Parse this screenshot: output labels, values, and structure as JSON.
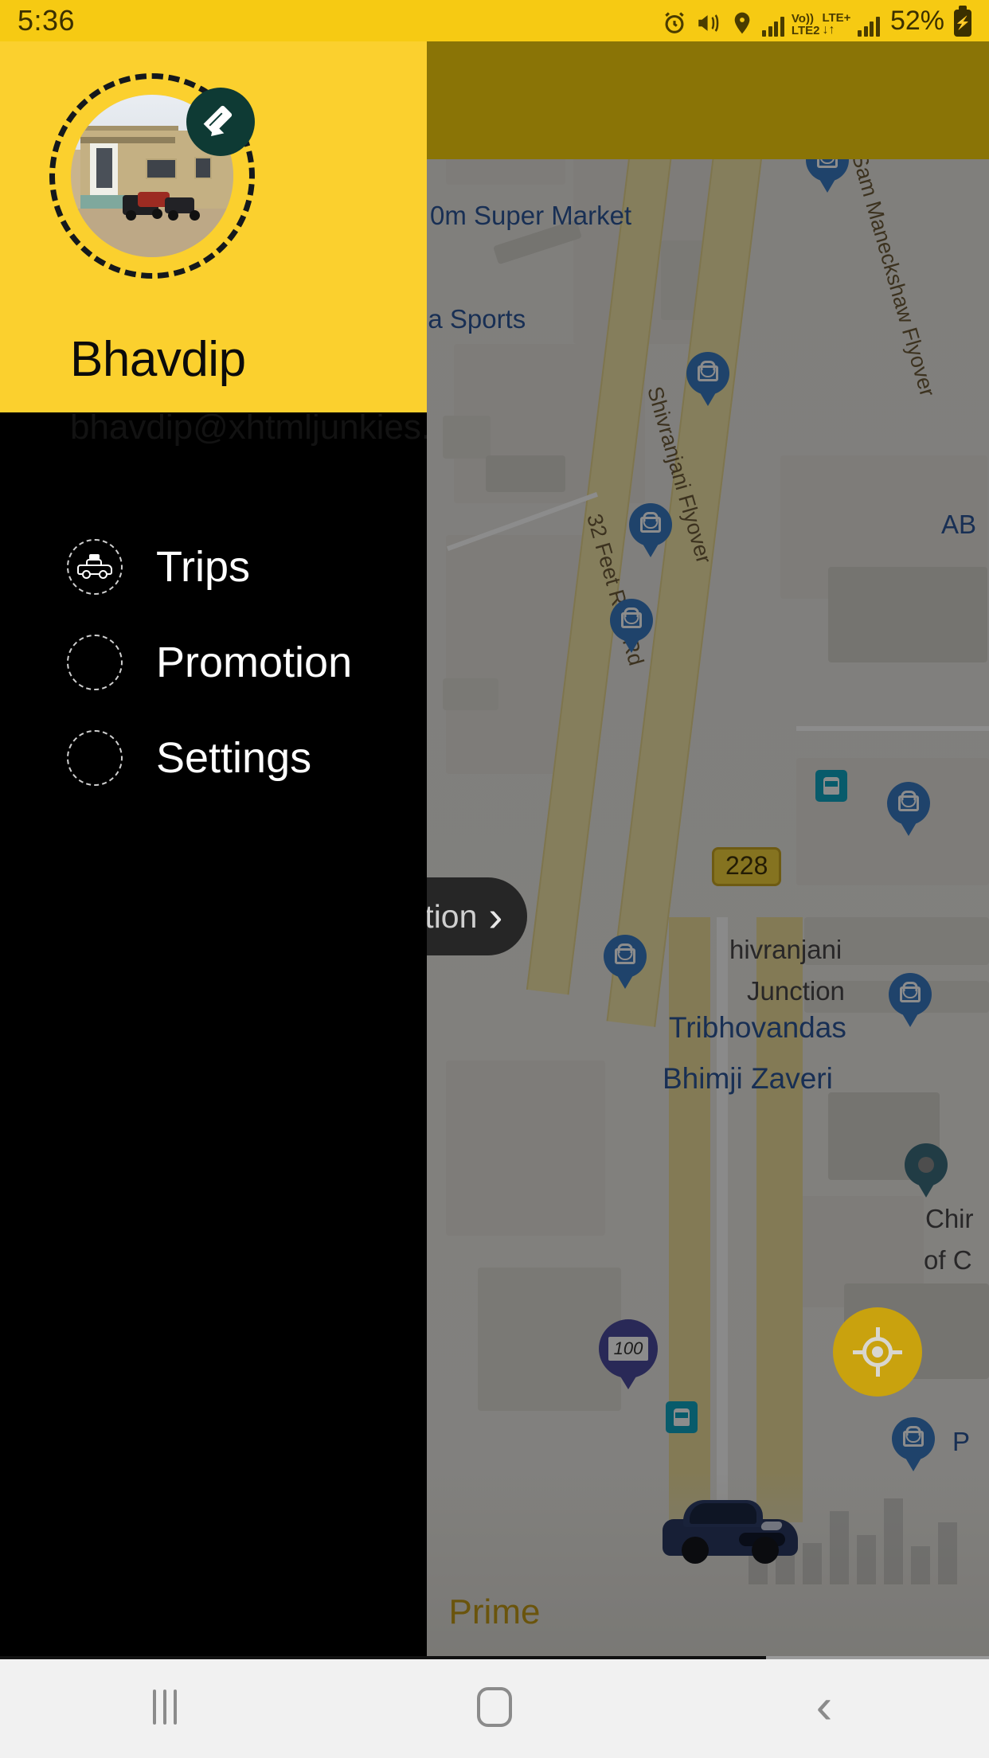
{
  "status_bar": {
    "time": "5:36",
    "battery_percent": "52%",
    "network_volte": "Vo))",
    "network_lte2": "LTE2",
    "network_lte_plus": "LTE+",
    "icons": [
      "alarm-icon",
      "vibrate-icon",
      "location-icon",
      "signal-bars-icon",
      "signal-bars-2-icon",
      "battery-charging-icon"
    ]
  },
  "drawer": {
    "user_name": "Bhavdip",
    "user_email": "bhavdip@xhtmljunkies.c",
    "edit_badge_icon": "pencil-icon",
    "avatar_alt": "profile-photo-house-with-motorcycles",
    "menu": [
      {
        "label": "Trips",
        "icon": "taxi-icon"
      },
      {
        "label": "Promotion",
        "icon": "promotion-badge-icon"
      },
      {
        "label": "Settings",
        "icon": "gear-icon"
      }
    ]
  },
  "map": {
    "location_pill_label": "cation",
    "location_pill_chevron": "›",
    "my_location_button_icon": "crosshair-icon",
    "road_labels": [
      "FM Sam Maneckshaw Flyover",
      "Shivranjani Flyover",
      "32 Feet Ring Rd"
    ],
    "route_shield": "228",
    "poi_labels": [
      "0m Super Market",
      "ia Sports",
      "AB",
      "hivranjani",
      "Junction",
      "Tribhovandas",
      "Bhimji Zaveri",
      "Chir",
      "of C",
      "P"
    ],
    "price_pin": "100",
    "transit_icon": "bus-stop-icon",
    "shop_pin_icon": "shopping-bag-pin-icon",
    "place_pin_icon": "map-pin-icon"
  },
  "vehicle_card": {
    "name": "Prime",
    "image_alt": "blue-sedan-car"
  },
  "nav_bar": {
    "recents_icon": "recents-icon",
    "home_icon": "home-icon",
    "back_icon": "back-icon"
  },
  "colors": {
    "brand_yellow": "#FBD02E",
    "status_yellow": "#F6CA13",
    "drawer_black": "#000000",
    "edit_badge_teal": "#0E3A34",
    "fab_gold": "#C9A20E",
    "prime_gold": "#C29A16",
    "map_poi_blue": "#2C5699"
  }
}
